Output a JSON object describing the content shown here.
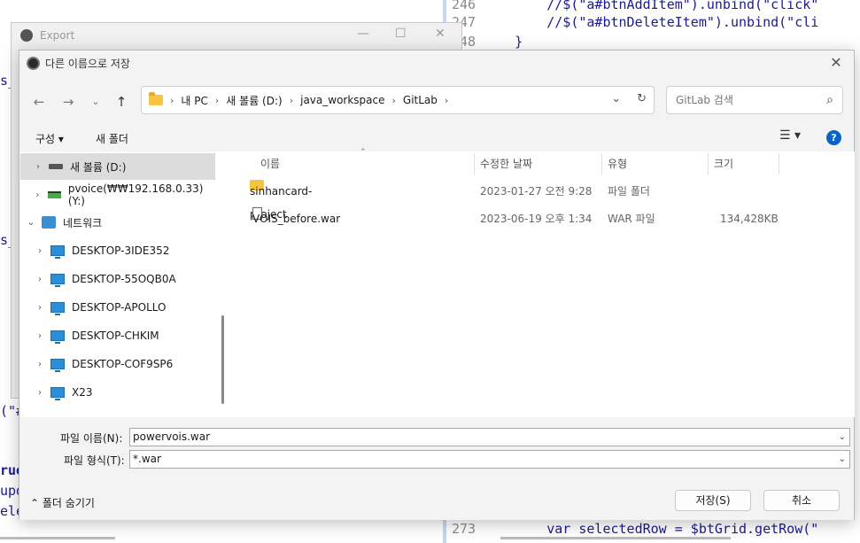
{
  "background": {
    "export_window_title": "Export",
    "editor_lines": [
      {
        "num": "246",
        "code": "        //$(\"a#btnAddItem\").unbind(\"click\""
      },
      {
        "num": "247",
        "code": "        //$(\"a#btnDeleteItem\").unbind(\"cli"
      },
      {
        "num": "248",
        "code": "    }"
      },
      {
        "num": "273",
        "code": "        var selectedRow = $btGrid.getRow(\""
      }
    ]
  },
  "dialog": {
    "title": "다른 이름으로 저장",
    "breadcrumb": [
      "내 PC",
      "새 볼륨 (D:)",
      "java_workspace",
      "GitLab"
    ],
    "search_placeholder": "GitLab 검색",
    "toolbar": {
      "organize": "구성 ▾",
      "new_folder": "새 폴더"
    },
    "nav_items": [
      {
        "label": "새 볼륨 (D:)",
        "icon": "drive-icon",
        "expand": "›"
      },
      {
        "label": "pvoice(₩₩192.168.0.33) (Y:)",
        "icon": "network-drive-icon",
        "expand": "›"
      },
      {
        "label": "네트워크",
        "icon": "network-icon",
        "expand": "⌄"
      },
      {
        "label": "DESKTOP-3IDE352",
        "icon": "computer-icon",
        "expand": "›"
      },
      {
        "label": "DESKTOP-55OQB0A",
        "icon": "computer-icon",
        "expand": "›"
      },
      {
        "label": "DESKTOP-APOLLO",
        "icon": "computer-icon",
        "expand": "›"
      },
      {
        "label": "DESKTOP-CHKIM",
        "icon": "computer-icon",
        "expand": "›"
      },
      {
        "label": "DESKTOP-COF9SP6",
        "icon": "computer-icon",
        "expand": "›"
      },
      {
        "label": "X23",
        "icon": "computer-icon",
        "expand": "›"
      }
    ],
    "columns": {
      "name": "이름",
      "modified": "수정한 날짜",
      "type": "유형",
      "size": "크기"
    },
    "files": [
      {
        "name": "sinhancard-project",
        "modified": "2023-01-27 오전 9:28",
        "type": "파일 폴더",
        "size": "",
        "icon": "folder-icon"
      },
      {
        "name": "VOIS_before.war",
        "modified": "2023-06-19 오후 1:34",
        "type": "WAR 파일",
        "size": "134,428KB",
        "icon": "file-icon"
      }
    ],
    "filename_label": "파일 이름(N):",
    "filename_value": "powervois.war",
    "filetype_label": "파일 형식(T):",
    "filetype_value": "*.war",
    "hide_folders": "폴더 숨기기",
    "save_button": "저장(S)",
    "cancel_button": "취소"
  }
}
